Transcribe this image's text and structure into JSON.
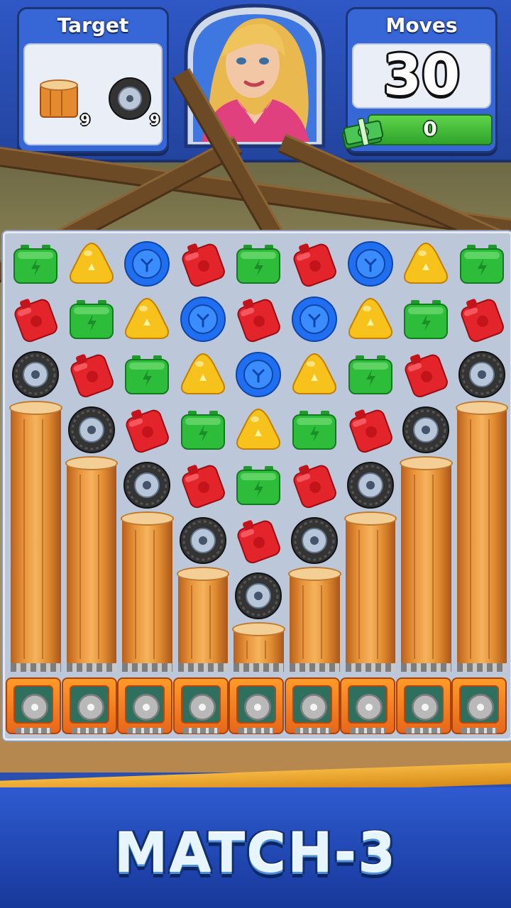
{
  "hud": {
    "target_title": "Target",
    "moves_title": "Moves",
    "moves_value": "30",
    "coins_value": "0",
    "targets": [
      {
        "icon": "log-icon",
        "count": "9"
      },
      {
        "icon": "tire-icon",
        "count": "9"
      }
    ]
  },
  "board": {
    "columns": 9,
    "rows": [
      [
        "green-battery",
        "yellow-cone",
        "blue-disc",
        "red-canister",
        "green-battery",
        "red-canister",
        "blue-disc",
        "yellow-cone",
        "green-battery"
      ],
      [
        "red-canister",
        "green-battery",
        "yellow-cone",
        "blue-disc",
        "red-canister",
        "blue-disc",
        "yellow-cone",
        "green-battery",
        "red-canister"
      ],
      [
        "tire",
        "red-canister",
        "green-battery",
        "yellow-cone",
        "blue-disc",
        "yellow-cone",
        "green-battery",
        "red-canister",
        "tire"
      ],
      [
        "log",
        "tire",
        "red-canister",
        "green-battery",
        "yellow-cone",
        "green-battery",
        "red-canister",
        "tire",
        "log"
      ],
      [
        "log",
        "log",
        "tire",
        "red-canister",
        "green-battery",
        "red-canister",
        "tire",
        "log",
        "log"
      ],
      [
        "log",
        "log",
        "log",
        "tire",
        "red-canister",
        "tire",
        "log",
        "log",
        "log"
      ],
      [
        "log",
        "log",
        "log",
        "log",
        "tire",
        "log",
        "log",
        "log",
        "log"
      ],
      [
        "log",
        "log",
        "log",
        "log",
        "log",
        "log",
        "log",
        "log",
        "log"
      ]
    ],
    "saw_count": 9
  },
  "colors": {
    "green": "#2ebd3a",
    "yellow": "#f7c21b",
    "blue": "#1f6ff0",
    "red": "#e3242b",
    "hud_blue": "#2f58c6"
  },
  "banner": {
    "text": "MATCH-3"
  }
}
